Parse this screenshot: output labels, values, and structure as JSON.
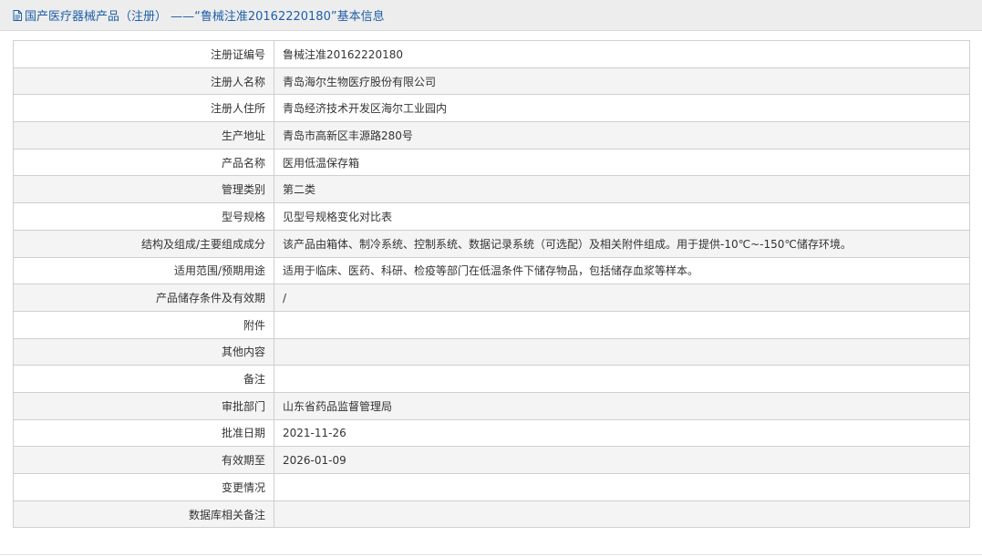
{
  "header": {
    "title": "国产医疗器械产品（注册） ——“鲁械注准20162220180”基本信息",
    "icon": "document-icon",
    "colors": {
      "title_text": "#1f5fa8",
      "title_background": "#ededed"
    }
  },
  "rows": [
    {
      "label": "注册证编号",
      "value": "鲁械注准20162220180"
    },
    {
      "label": "注册人名称",
      "value": "青岛海尔生物医疗股份有限公司"
    },
    {
      "label": "注册人住所",
      "value": "青岛经济技术开发区海尔工业园内"
    },
    {
      "label": "生产地址",
      "value": "青岛市高新区丰源路280号"
    },
    {
      "label": "产品名称",
      "value": "医用低温保存箱"
    },
    {
      "label": "管理类别",
      "value": "第二类"
    },
    {
      "label": "型号规格",
      "value": "见型号规格变化对比表"
    },
    {
      "label": "结构及组成/主要组成成分",
      "value": "该产品由箱体、制冷系统、控制系统、数据记录系统（可选配）及相关附件组成。用于提供-10℃~-150℃储存环境。"
    },
    {
      "label": "适用范围/预期用途",
      "value": "适用于临床、医药、科研、检疫等部门在低温条件下储存物品，包括储存血浆等样本。"
    },
    {
      "label": "产品储存条件及有效期",
      "value": "/"
    },
    {
      "label": "附件",
      "value": ""
    },
    {
      "label": "其他内容",
      "value": ""
    },
    {
      "label": "备注",
      "value": ""
    },
    {
      "label": "审批部门",
      "value": "山东省药品监督管理局"
    },
    {
      "label": "批准日期",
      "value": "2021-11-26"
    },
    {
      "label": "有效期至",
      "value": "2026-01-09"
    },
    {
      "label": "变更情况",
      "value": ""
    },
    {
      "label": "数据库相关备注",
      "value": ""
    }
  ]
}
